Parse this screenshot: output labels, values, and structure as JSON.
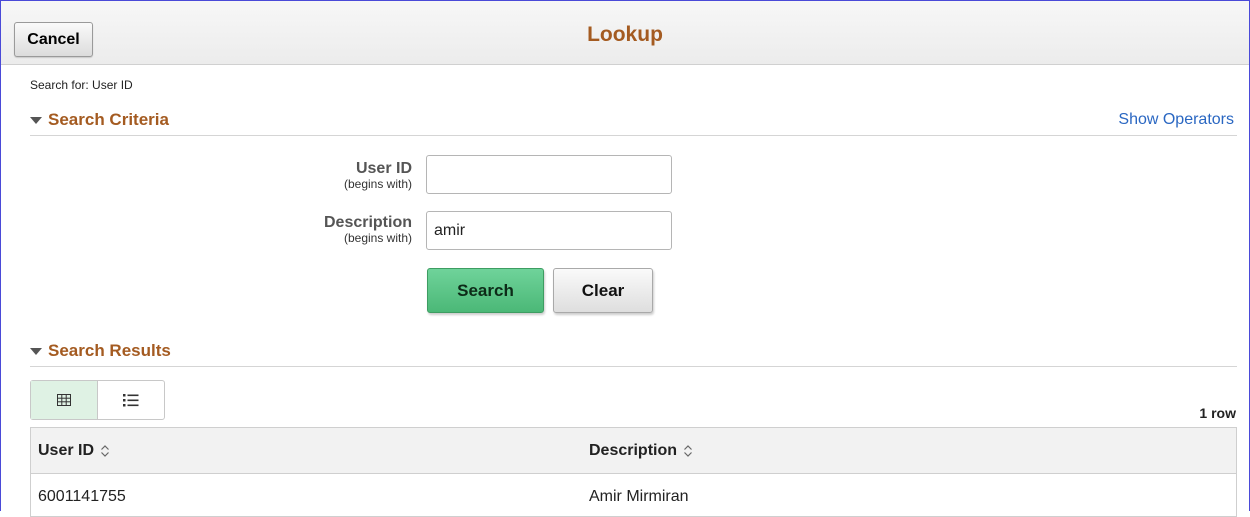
{
  "header": {
    "cancel_label": "Cancel",
    "title": "Lookup"
  },
  "search_for": "Search for:  User ID",
  "criteria": {
    "title": "Search Criteria",
    "show_operators": "Show Operators",
    "fields": [
      {
        "label": "User ID",
        "sublabel": "(begins with)",
        "value": ""
      },
      {
        "label": "Description",
        "sublabel": "(begins with)",
        "value": "amir"
      }
    ],
    "search_label": "Search",
    "clear_label": "Clear"
  },
  "results": {
    "title": "Search Results",
    "row_count": "1 row",
    "columns": [
      "User ID",
      "Description"
    ],
    "rows": [
      [
        "6001141755",
        "Amir Mirmiran"
      ]
    ]
  },
  "icons": {
    "expand": "triangle-down-icon",
    "grid_view": "grid-view-icon",
    "list_view": "list-view-icon",
    "sort": "sort-icon"
  },
  "colors": {
    "title": "#a45b21",
    "link": "#2a67c2",
    "search_button": "#55c080",
    "active_toggle": "#dff2e4"
  }
}
